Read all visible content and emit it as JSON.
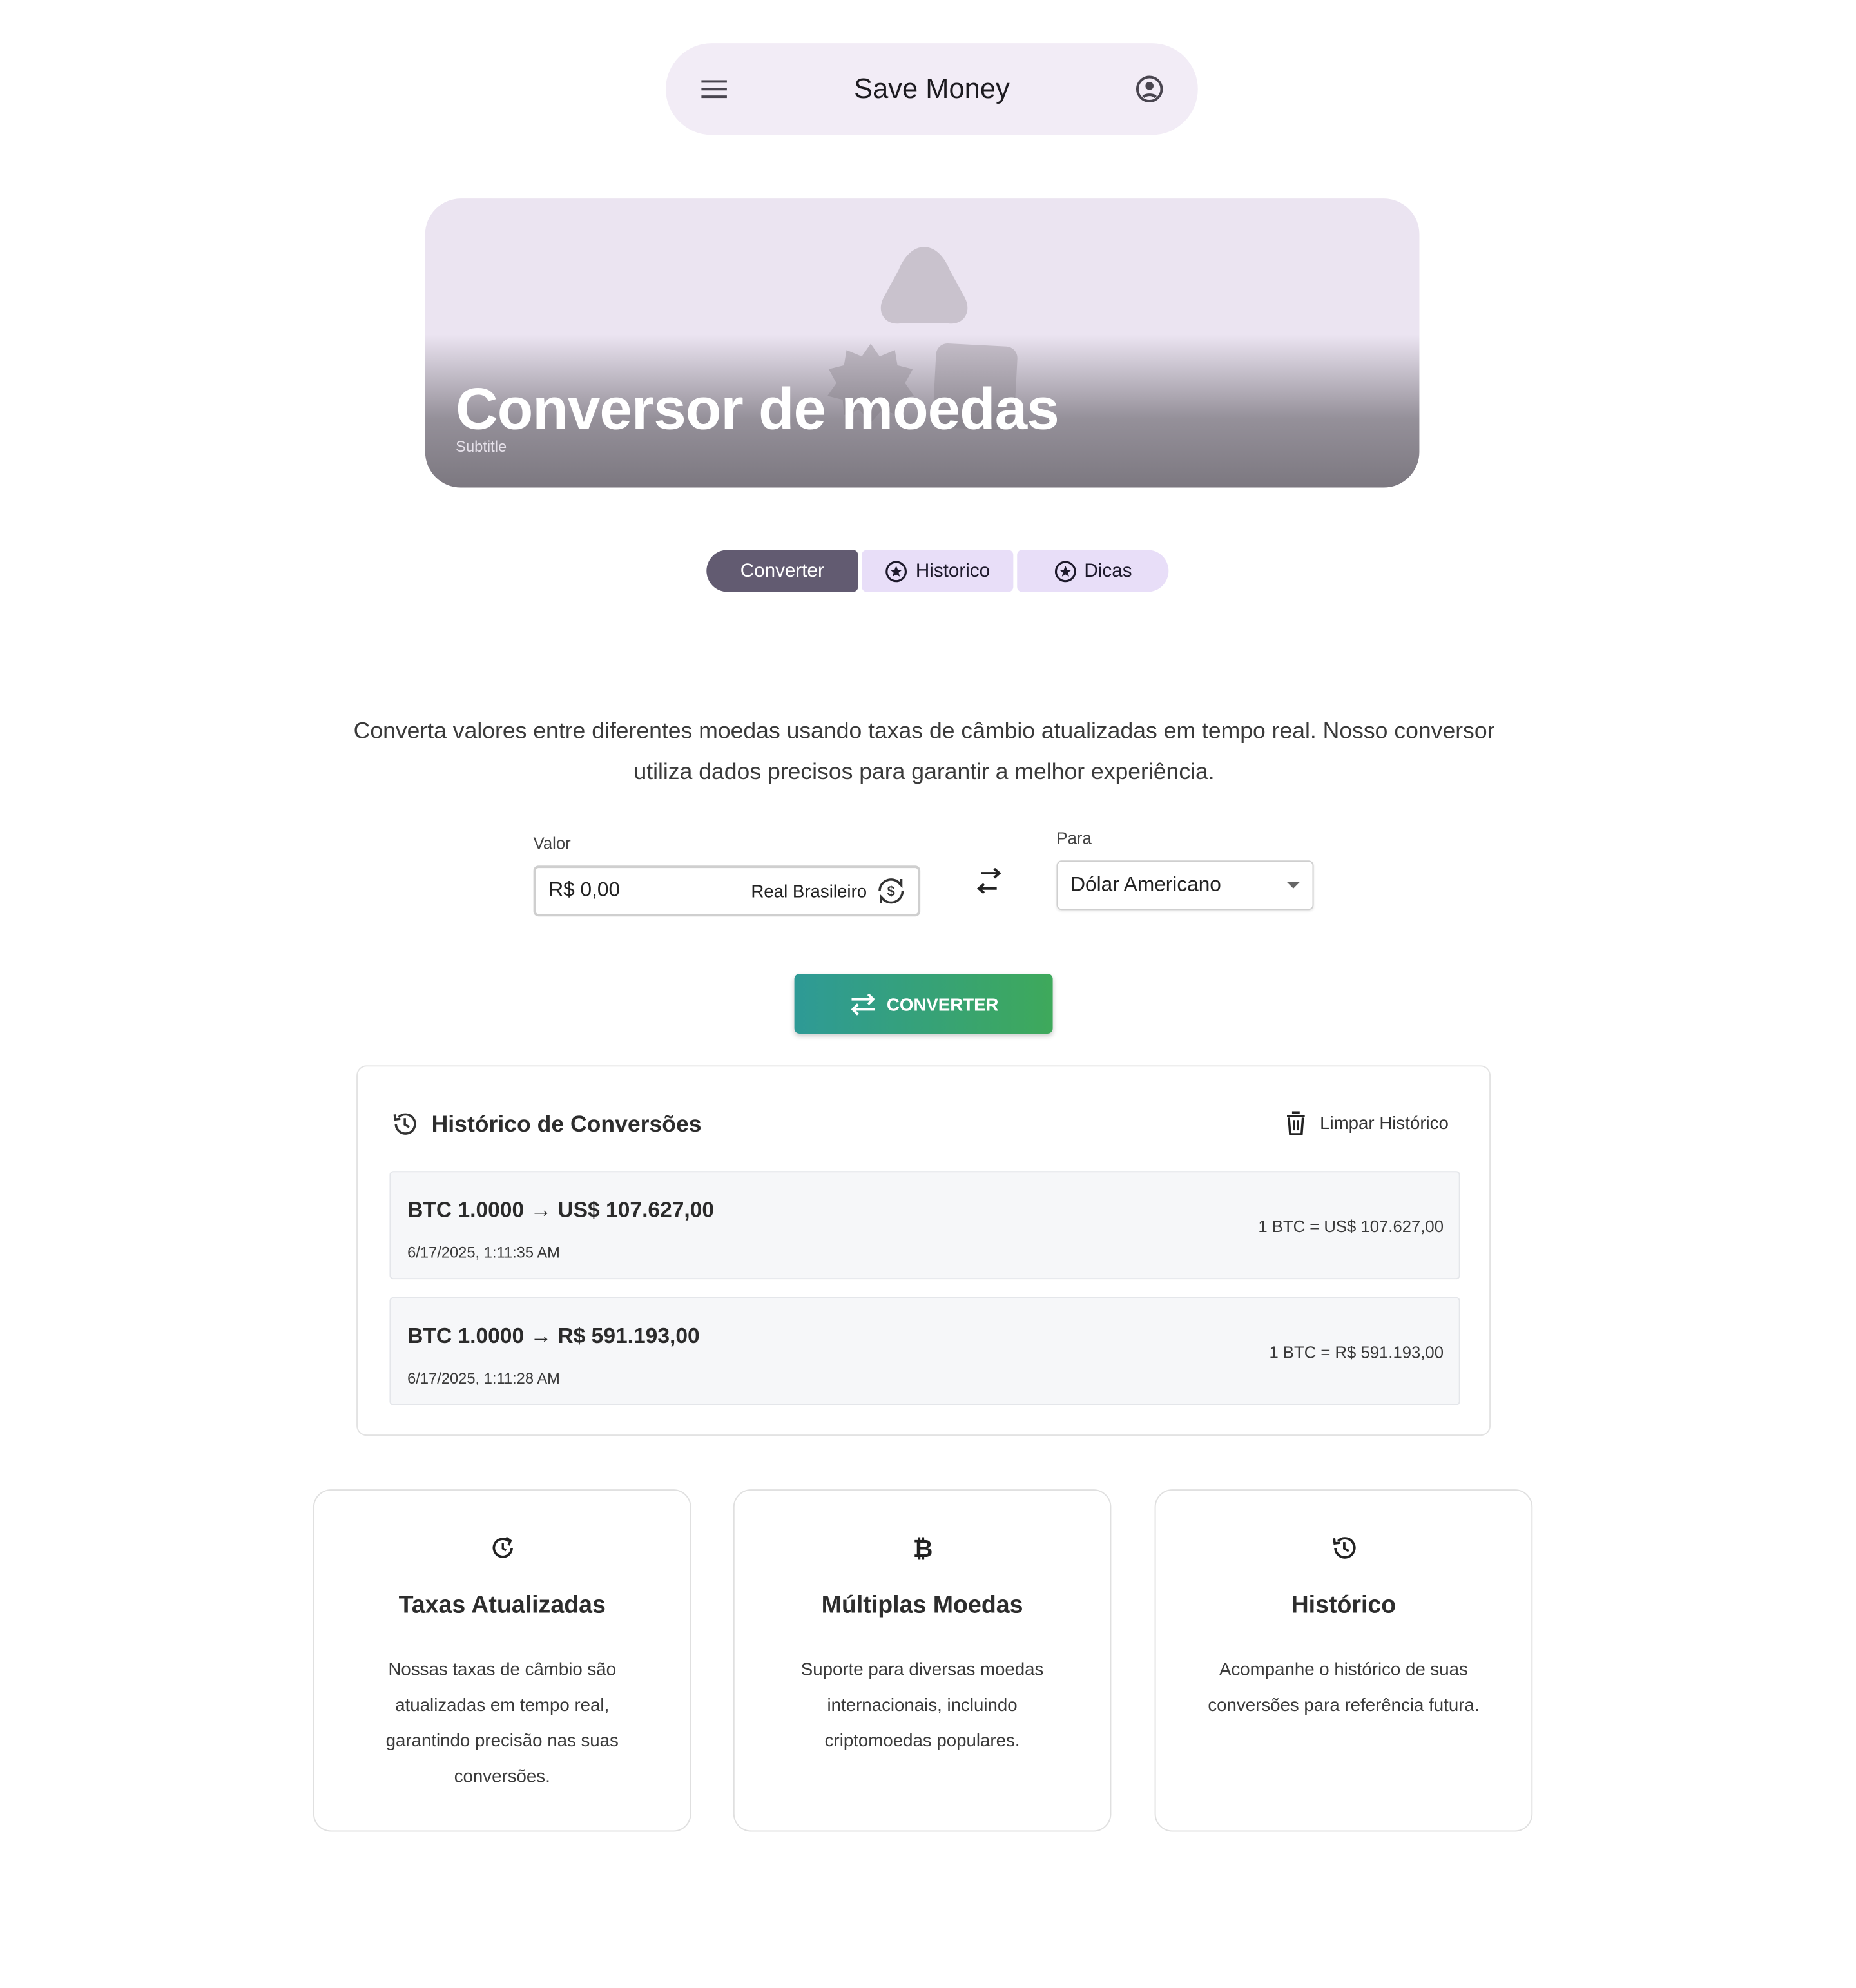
{
  "appbar": {
    "title": "Save Money",
    "menu_icon": "menu-icon",
    "account_icon": "account-circle-icon"
  },
  "hero": {
    "title": "Conversor de moedas",
    "subtitle": "Subtitle"
  },
  "tabs": [
    {
      "label": "Converter",
      "selected": true
    },
    {
      "label": "Historico",
      "icon": "star-circle-icon"
    },
    {
      "label": "Dicas",
      "icon": "star-circle-icon"
    }
  ],
  "intro": "Converta valores entre diferentes moedas usando taxas de câmbio atualizadas em tempo real. Nosso conversor utiliza dados precisos para garantir a melhor experiência.",
  "converter": {
    "valor_label": "Valor",
    "valor_value": "R$ 0,00",
    "from_currency": "Real Brasileiro",
    "para_label": "Para",
    "to_currency": "Dólar Americano",
    "button_label": "CONVERTER"
  },
  "history": {
    "title": "Histórico de Conversões",
    "clear_label": "Limpar Histórico",
    "items": [
      {
        "main": "BTC 1.0000 → US$ 107.627,00",
        "time": "6/17/2025, 1:11:35 AM",
        "rate": "1 BTC = US$ 107.627,00"
      },
      {
        "main": "BTC 1.0000 → R$ 591.193,00",
        "time": "6/17/2025, 1:11:28 AM",
        "rate": "1 BTC = R$ 591.193,00"
      }
    ]
  },
  "features": [
    {
      "title": "Taxas Atualizadas",
      "desc": "Nossas taxas de câmbio são atualizadas em tempo real, garantindo precisão nas suas conversões.",
      "icon": "refresh-clock-icon"
    },
    {
      "title": "Múltiplas Moedas",
      "desc": "Suporte para diversas moedas internacionais, incluindo criptomoedas populares.",
      "icon": "bitcoin-icon"
    },
    {
      "title": "Histórico",
      "desc": "Acompanhe o histórico de suas conversões para referência futura.",
      "icon": "history-icon"
    }
  ],
  "colors": {
    "primary": "#625b71",
    "tab_bg": "#e8def8",
    "appbar_bg": "#f2ecf6",
    "btn_start": "#2e9a96",
    "btn_end": "#3ea95b"
  }
}
